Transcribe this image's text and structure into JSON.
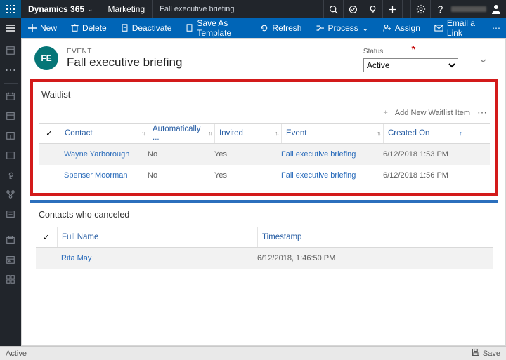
{
  "topbar": {
    "product": "Dynamics 365",
    "area": "Marketing",
    "page": "Fall executive briefing"
  },
  "cmdbar": {
    "new": "New",
    "delete": "Delete",
    "deactivate": "Deactivate",
    "save_as": "Save As Template",
    "refresh": "Refresh",
    "process": "Process",
    "assign": "Assign",
    "email": "Email a Link"
  },
  "record": {
    "badge": "FE",
    "type": "EVENT",
    "title": "Fall executive briefing",
    "status_label": "Status",
    "status_value": "Active"
  },
  "waitlist": {
    "title": "Waitlist",
    "add_label": "Add New Waitlist Item",
    "headers": {
      "contact": "Contact",
      "auto": "Automatically ...",
      "invited": "Invited",
      "event": "Event",
      "created": "Created On"
    },
    "rows": [
      {
        "contact": "Wayne Yarborough",
        "auto": "No",
        "invited": "Yes",
        "event": "Fall executive briefing",
        "created": "6/12/2018 1:53 PM"
      },
      {
        "contact": "Spenser Moorman",
        "auto": "No",
        "invited": "Yes",
        "event": "Fall executive briefing",
        "created": "6/12/2018 1:56 PM"
      }
    ]
  },
  "canceled": {
    "title": "Contacts who canceled",
    "headers": {
      "name": "Full Name",
      "ts": "Timestamp"
    },
    "rows": [
      {
        "name": "Rita May",
        "ts": "6/12/2018, 1:46:50 PM"
      }
    ]
  },
  "footer": {
    "status": "Active",
    "save": "Save"
  }
}
